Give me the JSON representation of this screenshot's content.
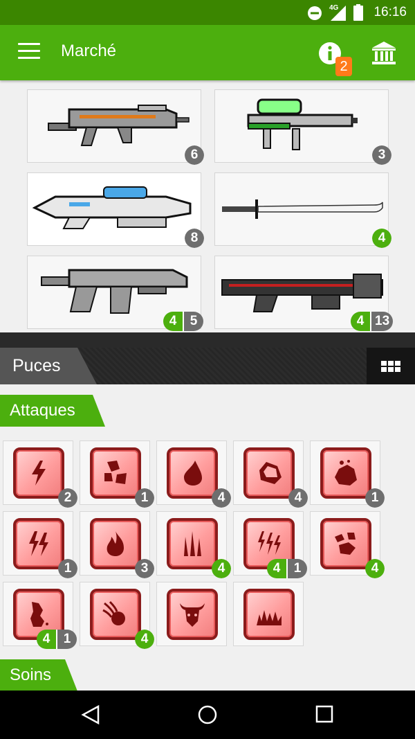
{
  "status_bar": {
    "time": "16:16",
    "network": "4G",
    "icons": [
      "dnd-icon",
      "signal-icon",
      "battery-icon"
    ]
  },
  "app_bar": {
    "title": "Marché",
    "notification_count": "2",
    "icons": [
      "menu-icon",
      "info-icon",
      "bank-icon"
    ]
  },
  "weapons": [
    {
      "name": "rifle-orange",
      "counts": [
        {
          "value": "6",
          "style": "dark"
        }
      ]
    },
    {
      "name": "laser-gun-green",
      "counts": [
        {
          "value": "3",
          "style": "dark"
        }
      ]
    },
    {
      "name": "plasma-gun-blue",
      "counts": [
        {
          "value": "8",
          "style": "dark"
        }
      ]
    },
    {
      "name": "katana",
      "counts": [
        {
          "value": "4",
          "style": "green"
        }
      ]
    },
    {
      "name": "machine-gun-grey",
      "counts": [
        {
          "value": "4",
          "style": "green"
        },
        {
          "value": "5",
          "style": "dark"
        }
      ]
    },
    {
      "name": "rocket-launcher-red",
      "counts": [
        {
          "value": "4",
          "style": "green"
        },
        {
          "value": "13",
          "style": "dark"
        }
      ]
    }
  ],
  "section": {
    "title": "Puces",
    "grid_icon": "grid-icon"
  },
  "categories": {
    "attacks": "Attaques",
    "heals": "Soins"
  },
  "chips": [
    {
      "icon": "lightning-icon",
      "counts": [
        {
          "value": "2",
          "style": "dark"
        }
      ]
    },
    {
      "icon": "rocks-icon",
      "counts": [
        {
          "value": "1",
          "style": "dark"
        }
      ]
    },
    {
      "icon": "drop-icon",
      "counts": [
        {
          "value": "4",
          "style": "dark"
        }
      ]
    },
    {
      "icon": "stone-icon",
      "counts": [
        {
          "value": "4",
          "style": "dark"
        }
      ]
    },
    {
      "icon": "boulder-icon",
      "counts": [
        {
          "value": "1",
          "style": "dark"
        }
      ]
    },
    {
      "icon": "double-lightning-icon",
      "counts": [
        {
          "value": "1",
          "style": "dark"
        }
      ]
    },
    {
      "icon": "flame-icon",
      "counts": [
        {
          "value": "3",
          "style": "dark"
        }
      ]
    },
    {
      "icon": "spikes-icon",
      "counts": [
        {
          "value": "4",
          "style": "green"
        }
      ]
    },
    {
      "icon": "triple-lightning-icon",
      "counts": [
        {
          "value": "4",
          "style": "green"
        },
        {
          "value": "1",
          "style": "dark"
        }
      ]
    },
    {
      "icon": "rock-burst-icon",
      "counts": [
        {
          "value": "4",
          "style": "green"
        }
      ]
    },
    {
      "icon": "lava-icon",
      "counts": [
        {
          "value": "4",
          "style": "green"
        },
        {
          "value": "1",
          "style": "dark"
        }
      ]
    },
    {
      "icon": "meteor-icon",
      "counts": [
        {
          "value": "4",
          "style": "green"
        }
      ]
    },
    {
      "icon": "bull-icon",
      "counts": []
    },
    {
      "icon": "fire-wall-icon",
      "counts": []
    }
  ],
  "nav_bar": {
    "icons": [
      "back-icon",
      "home-icon",
      "recents-icon"
    ]
  },
  "colors": {
    "accent": "#4caf0e",
    "status_bar": "#3b8600",
    "badge": "#ff7a1a",
    "chip_border": "#8b1c1c"
  }
}
